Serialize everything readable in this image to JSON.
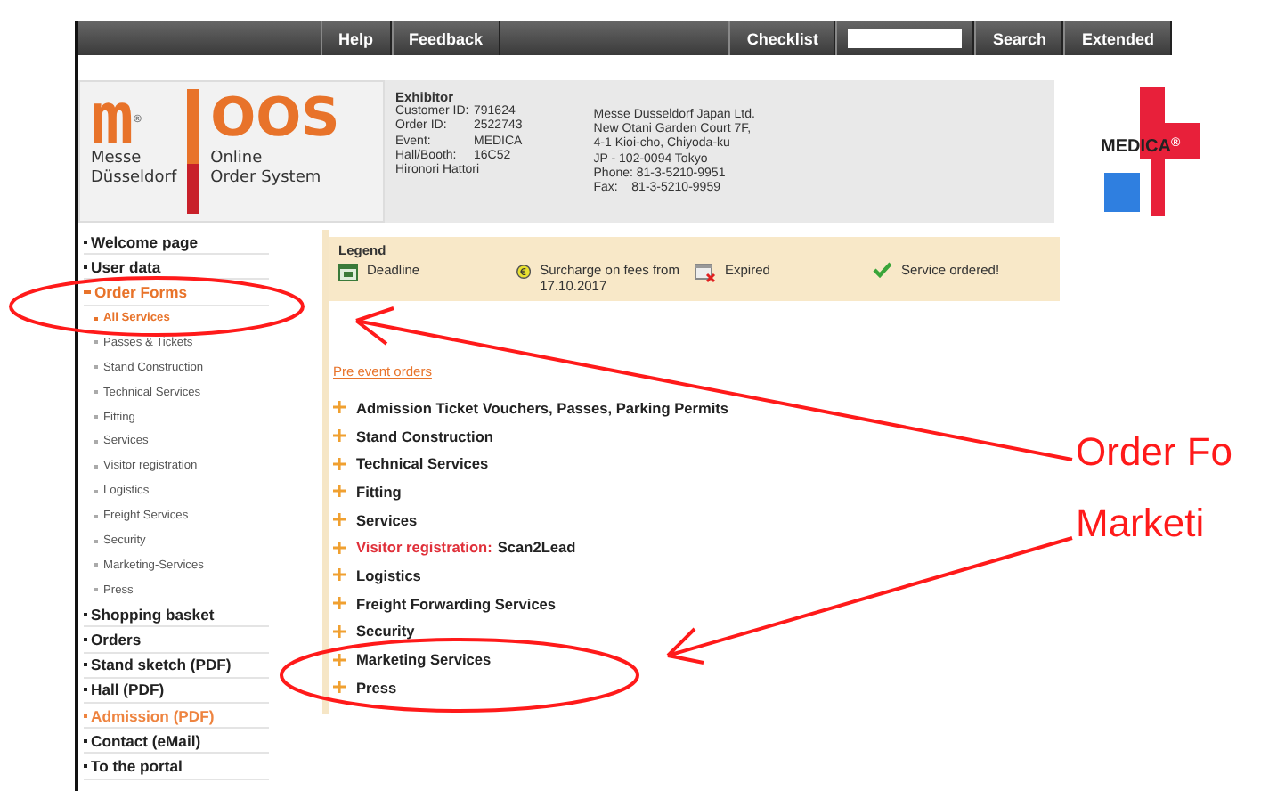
{
  "nav": {
    "links": [
      "Help",
      "Feedback"
    ],
    "checklist": "Checklist",
    "search_button": "Search",
    "extended": "Extended"
  },
  "logo": {
    "mark": "m",
    "registered": "®",
    "brand_line1": "Messe",
    "brand_line2": "Düsseldorf",
    "system": "OOS",
    "system_line1": "Online",
    "system_line2": "Order System"
  },
  "exhibitor": {
    "heading": "Exhibitor",
    "rows": [
      {
        "label": "Customer ID:",
        "value": "791624"
      },
      {
        "label": "Order ID:",
        "value": "2522743"
      },
      {
        "label": "Event:",
        "value": "MEDICA"
      },
      {
        "label": "Hall/Booth:",
        "value": "16C52"
      }
    ],
    "name": "Hironori Hattori"
  },
  "address": [
    "Messe Dusseldorf Japan Ltd.",
    "New Otani Garden Court 7F,",
    "4-1 Kioi-cho, Chiyoda-ku",
    "JP - 102-0094 Tokyo",
    "Phone: 81-3-5210-9951",
    "Fax:    81-3-5210-9959"
  ],
  "event_logo": {
    "text": "MEDICA",
    "registered": "®"
  },
  "sidebar": {
    "items": [
      {
        "label": "Welcome page",
        "selected": false,
        "highlighted": false
      },
      {
        "label": "User data",
        "selected": false,
        "highlighted": false
      },
      {
        "label": "Order Forms",
        "selected": true,
        "highlighted": false,
        "children": [
          {
            "label": "All Services",
            "selected": true
          },
          {
            "label": "Passes & Tickets",
            "selected": false
          },
          {
            "label": "Stand Construction",
            "selected": false
          },
          {
            "label": "Technical Services",
            "selected": false
          },
          {
            "label": "Fitting",
            "selected": false
          },
          {
            "label": "Services",
            "selected": false
          },
          {
            "label": "Visitor registration",
            "selected": false
          },
          {
            "label": "Logistics",
            "selected": false
          },
          {
            "label": "Freight Services",
            "selected": false
          },
          {
            "label": "Security",
            "selected": false
          },
          {
            "label": "Marketing-Services",
            "selected": false
          },
          {
            "label": "Press",
            "selected": false
          }
        ]
      },
      {
        "label": "Shopping basket",
        "selected": false,
        "highlighted": false
      },
      {
        "label": "Orders",
        "selected": false,
        "highlighted": false
      },
      {
        "label": "Stand sketch (PDF)",
        "selected": false,
        "highlighted": false
      },
      {
        "label": "Hall (PDF)",
        "selected": false,
        "highlighted": false
      },
      {
        "label": "Admission (PDF)",
        "selected": false,
        "highlighted": true
      },
      {
        "label": "Contact (eMail)",
        "selected": false,
        "highlighted": false
      },
      {
        "label": "To the portal",
        "selected": false,
        "highlighted": false
      }
    ]
  },
  "legend": {
    "title": "Legend",
    "items": [
      {
        "kind": "deadline",
        "label": "Deadline"
      },
      {
        "kind": "surcharge",
        "label": "Surcharge on fees from 17.10.2017"
      },
      {
        "kind": "expired",
        "label": "Expired"
      },
      {
        "kind": "ordered",
        "label": "Service ordered!"
      }
    ]
  },
  "section_link": "Pre event orders",
  "order_groups": [
    {
      "label": "Admission Ticket Vouchers, Passes, Parking Permits"
    },
    {
      "label": "Stand Construction"
    },
    {
      "label": "Technical Services"
    },
    {
      "label": "Fitting"
    },
    {
      "label": "Services"
    },
    {
      "flag": "Visitor registration:",
      "label": "Scan2Lead"
    },
    {
      "label": "Logistics"
    },
    {
      "label": "Freight Forwarding Services"
    },
    {
      "label": "Security"
    },
    {
      "label": "Marketing Services"
    },
    {
      "label": "Press"
    }
  ],
  "annotations": [
    "Order Fo",
    "Marketi"
  ]
}
